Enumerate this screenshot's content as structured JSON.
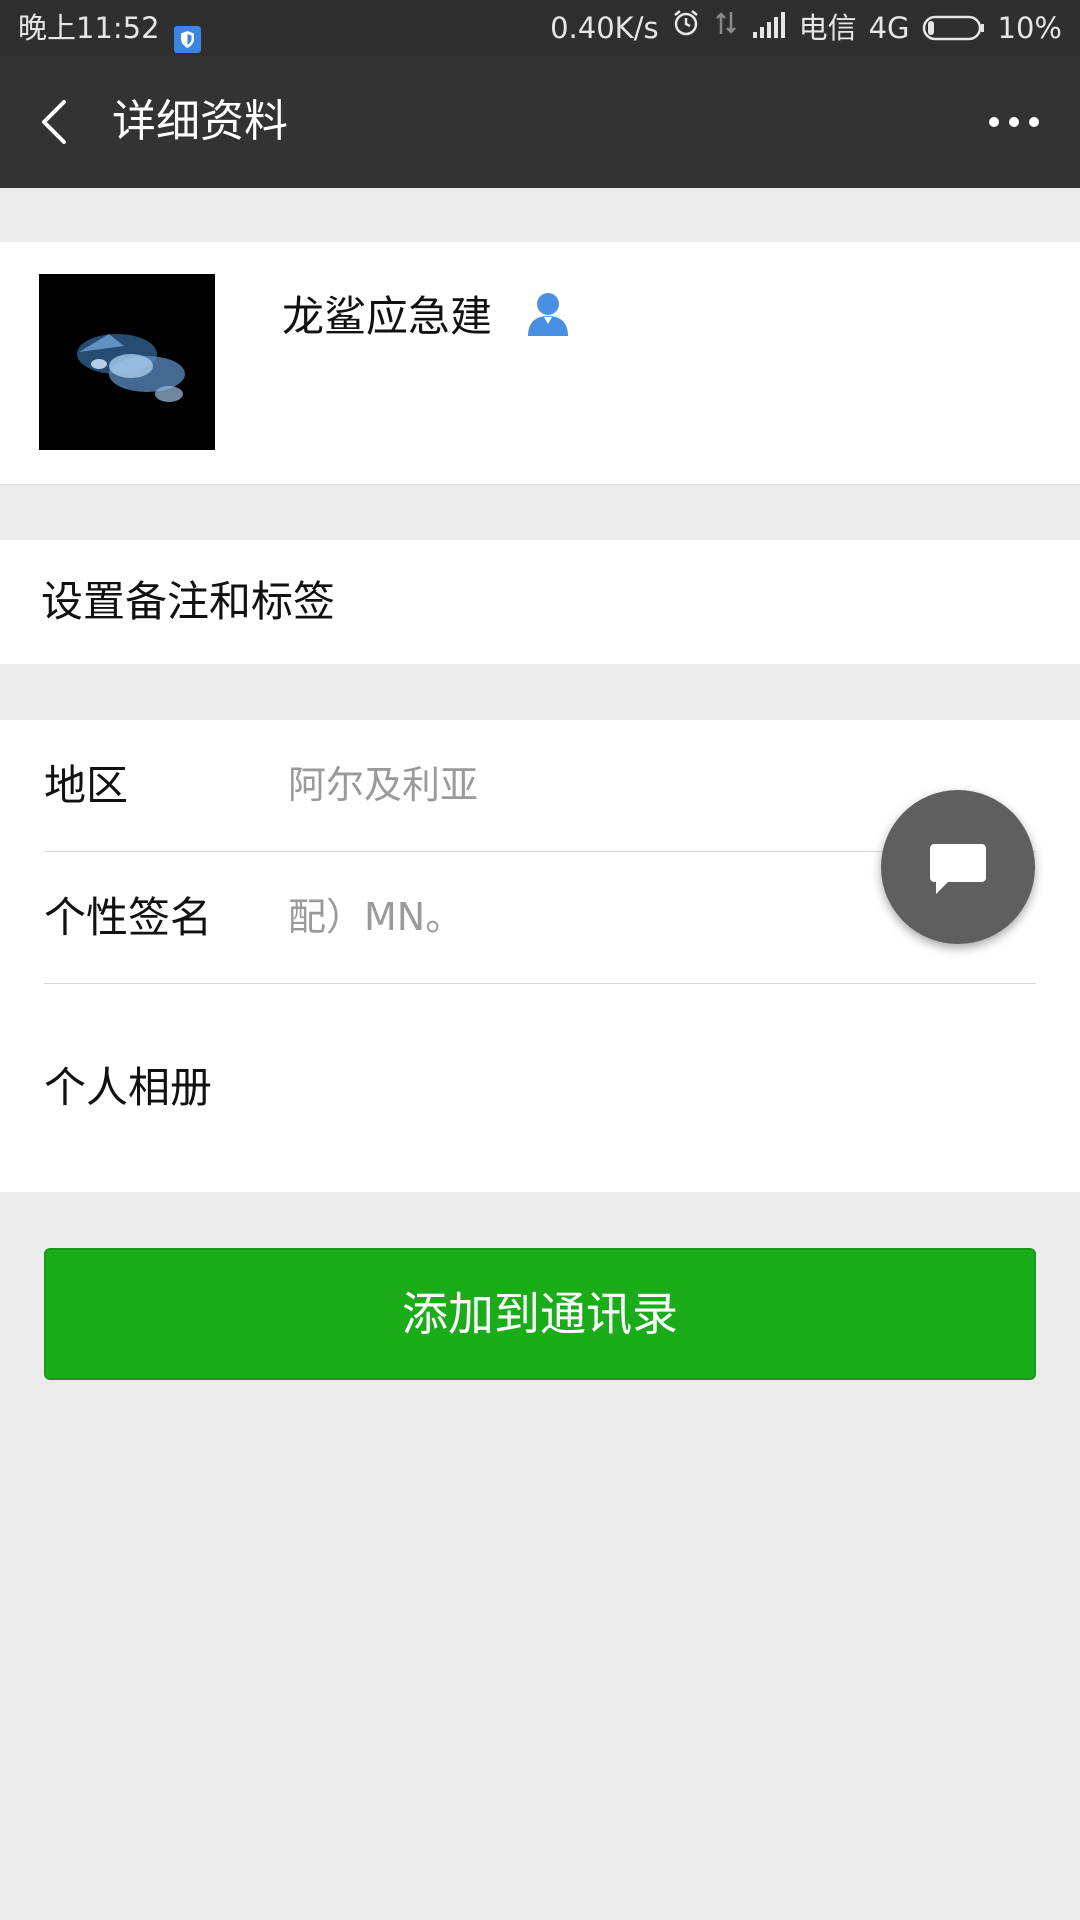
{
  "status_bar": {
    "time": "晚上11:52",
    "net_speed": "0.40K/s",
    "carrier": "电信",
    "network": "4G",
    "battery": "10%",
    "icons": [
      "shield-icon",
      "alarm-icon",
      "data-arrows-icon",
      "signal-icon",
      "battery-icon"
    ]
  },
  "header": {
    "title": "详细资料",
    "back_icon": "back-chevron-icon",
    "more_icon": "more-dots-icon"
  },
  "profile": {
    "nickname": "龙鲨应急建",
    "contact_icon": "person-icon",
    "contact_icon_color": "#4a90e2"
  },
  "remark": {
    "label": "设置备注和标签"
  },
  "info": {
    "region_label": "地区",
    "region_value": "阿尔及利亚",
    "signature_label": "个性签名",
    "signature_value": "配）MN。",
    "album_label": "个人相册"
  },
  "floating": {
    "icon": "chat-bubble-icon"
  },
  "actions": {
    "add_contact": "添加到通讯录",
    "accent_color": "#1aad19"
  }
}
